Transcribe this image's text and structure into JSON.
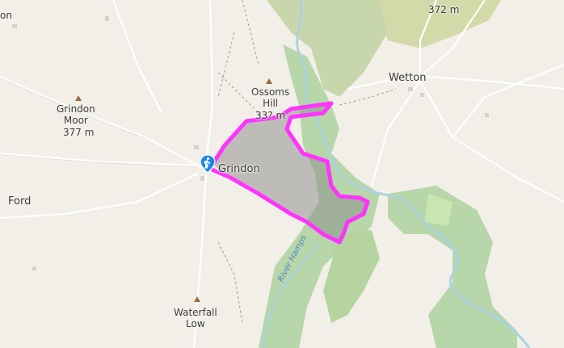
{
  "map": {
    "places": {
      "wetton": "Wetton",
      "grindon": "Grindon",
      "ford": "Ford"
    },
    "peaks": {
      "grindon_moor": {
        "name": "Grindon\nMoor",
        "elev": "377 m"
      },
      "ossoms_hill": {
        "name": "Ossoms\nHill",
        "elev": "33? m"
      },
      "waterfall_low": {
        "name": "Waterfall\nLow",
        "elev": ""
      },
      "top_peak": {
        "name": "",
        "elev": "372 m"
      }
    },
    "river": "River Hamps",
    "top_left_label": "on",
    "colors": {
      "background": "#f2efe9",
      "woodland": "#add19e",
      "heath": "#c8d7ab",
      "route": "#ff33ff",
      "route_fill": "#888888",
      "water": "#aad3df",
      "marker": "#1e88e5"
    },
    "marker_icon": "hiker-icon"
  }
}
